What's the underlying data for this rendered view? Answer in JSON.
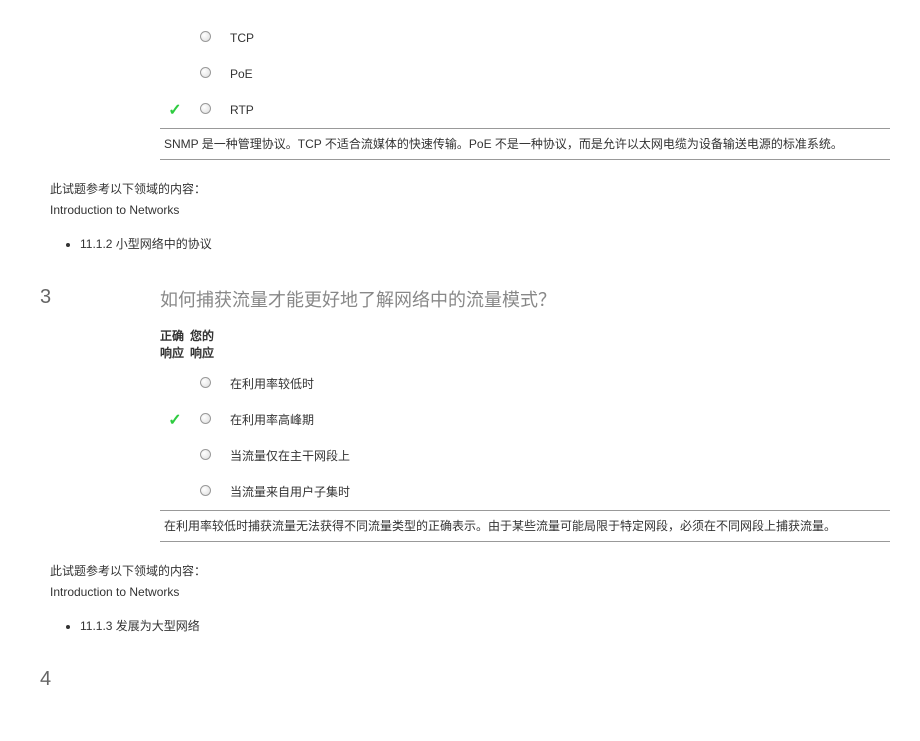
{
  "q2": {
    "options": [
      {
        "text": "TCP",
        "correct": false
      },
      {
        "text": "PoE",
        "correct": false
      },
      {
        "text": "RTP",
        "correct": true
      }
    ],
    "explanation": "SNMP 是一种管理协议。TCP 不适合流媒体的快速传输。PoE 不是一种协议，而是允许以太网电缆为设备输送电源的标准系统。",
    "refTitle": "此试题参考以下领域的内容：",
    "refSub": "Introduction to Networks",
    "refItem": "11.1.2 小型网络中的协议"
  },
  "q3": {
    "number": "3",
    "text": "如何捕获流量才能更好地了解网络中的流量模式？",
    "hdr1a": "正确",
    "hdr1b": "响应",
    "hdr2a": "您的",
    "hdr2b": "响应",
    "options": [
      {
        "text": "在利用率较低时",
        "correct": false
      },
      {
        "text": "在利用率高峰期",
        "correct": true
      },
      {
        "text": "当流量仅在主干网段上",
        "correct": false
      },
      {
        "text": "当流量来自用户子集时",
        "correct": false
      }
    ],
    "explanation": "在利用率较低时捕获流量无法获得不同流量类型的正确表示。由于某些流量可能局限于特定网段，必须在不同网段上捕获流量。",
    "refTitle": "此试题参考以下领域的内容：",
    "refSub": "Introduction to Networks",
    "refItem": "11.1.3 发展为大型网络"
  },
  "q4": {
    "number": "4"
  }
}
